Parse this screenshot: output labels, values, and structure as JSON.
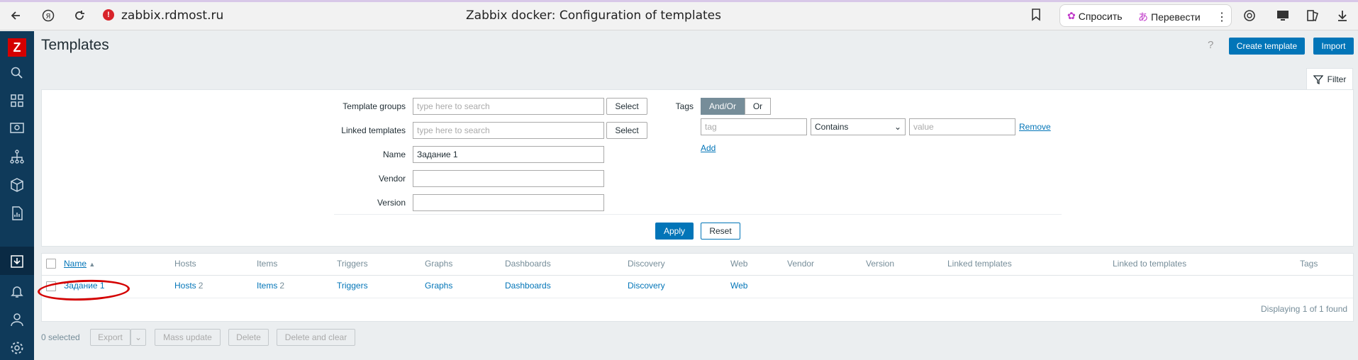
{
  "browser": {
    "url": "zabbix.rdmost.ru",
    "tab_title": "Zabbix docker: Configuration of templates",
    "ask_label": "Спросить",
    "translate_label": "Перевести"
  },
  "sidebar": {
    "logo": "Z",
    "items": [
      "search-icon",
      "dashboards-icon",
      "monitoring-icon",
      "services-icon",
      "inventory-icon",
      "reports-icon",
      "data-collection-icon",
      "alerts-icon",
      "users-icon",
      "administration-icon"
    ]
  },
  "header": {
    "title": "Templates",
    "help": "?",
    "create_label": "Create template",
    "import_label": "Import"
  },
  "filter": {
    "tab_label": "Filter",
    "template_groups_label": "Template groups",
    "template_groups_placeholder": "type here to search",
    "linked_templates_label": "Linked templates",
    "linked_templates_placeholder": "type here to search",
    "select_label": "Select",
    "name_label": "Name",
    "name_value": "Задание 1",
    "vendor_label": "Vendor",
    "vendor_value": "",
    "version_label": "Version",
    "version_value": "",
    "tags_label": "Tags",
    "andor_label": "And/Or",
    "or_label": "Or",
    "tag_placeholder": "tag",
    "operator_value": "Contains",
    "value_placeholder": "value",
    "remove_label": "Remove",
    "add_label": "Add",
    "apply_label": "Apply",
    "reset_label": "Reset"
  },
  "table": {
    "columns": [
      "Name",
      "Hosts",
      "Items",
      "Triggers",
      "Graphs",
      "Dashboards",
      "Discovery",
      "Web",
      "Vendor",
      "Version",
      "Linked templates",
      "Linked to templates",
      "Tags"
    ],
    "sort_indicator": "▲",
    "rows": [
      {
        "name": "Задание 1",
        "hosts": "Hosts",
        "hosts_count": "2",
        "items": "Items",
        "items_count": "2",
        "triggers": "Triggers",
        "graphs": "Graphs",
        "dashboards": "Dashboards",
        "discovery": "Discovery",
        "web": "Web"
      }
    ],
    "displaying": "Displaying 1 of 1 found"
  },
  "footer": {
    "selected": "0 selected",
    "export_label": "Export",
    "mass_update_label": "Mass update",
    "delete_label": "Delete",
    "delete_clear_label": "Delete and clear"
  }
}
